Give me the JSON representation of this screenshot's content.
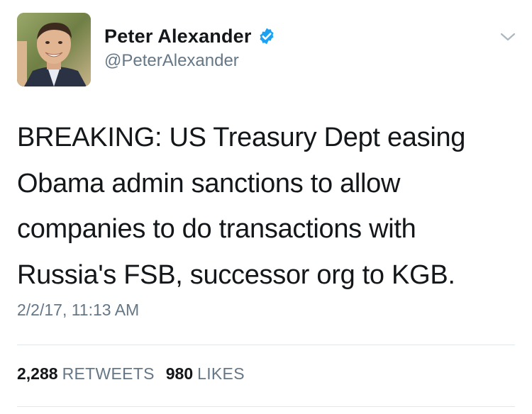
{
  "user": {
    "display_name": "Peter Alexander",
    "handle": "@PeterAlexander",
    "verified": true,
    "avatar_icon": "profile-photo"
  },
  "tweet": {
    "text_lines": [
      "BREAKING: US Treasury Dept easing",
      "Obama admin sanctions to allow",
      "companies to do transactions with",
      "Russia's FSB, successor org to KGB."
    ],
    "timestamp": "2/2/17, 11:13 AM"
  },
  "stats": {
    "retweets": {
      "count": "2,288",
      "label": "RETWEETS"
    },
    "likes": {
      "count": "980",
      "label": "LIKES"
    }
  },
  "colors": {
    "text": "#14171a",
    "secondary": "#657786",
    "verified_badge": "#1da1f2",
    "divider": "#e1e8ed"
  },
  "icons": {
    "verified": "verified-badge-icon",
    "menu": "chevron-down-icon"
  }
}
